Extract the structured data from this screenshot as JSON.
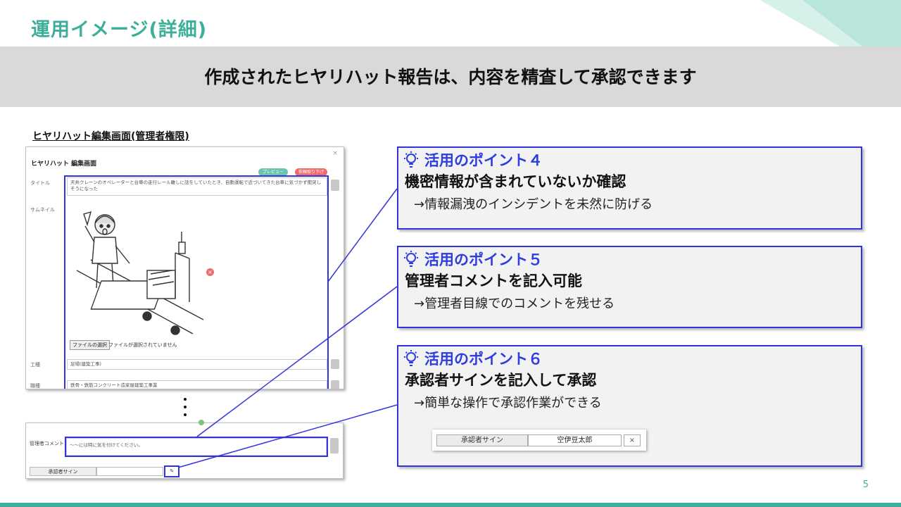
{
  "slide": {
    "title": "運用イメージ(詳細)",
    "headline": "作成されたヒヤリハット報告は、内容を精査して承認できます",
    "page_number": "5",
    "accent_color": "#3dae9a",
    "callout_color": "#2d3de0"
  },
  "screenshot_caption": "ヒヤリハット編集画面(管理者権限)",
  "edit_screen": {
    "title": "ヒヤリハット 編集画面",
    "close_icon": "close-icon",
    "preview_button": "プレビュー",
    "withdraw_button": "依頼取り下げ",
    "fields": {
      "title_label": "タイトル",
      "title_value": "天井クレーンのオペレーターと台車の走行レール離しに話をしていたとき、自動運転で近づいてきた台車に気づかず衝突しそうになった",
      "thumbnail_label": "サムネイル",
      "file_button": "ファイルの選択",
      "file_status": "ファイルが選択されていません",
      "work_type_label": "工種",
      "work_type_value": "足場(建築工事)",
      "job_type_label": "職種",
      "job_type_value": "鉄骨・鉄筋コンクリート造家屋建築工事業"
    },
    "remove_image_icon": "remove-circle-icon"
  },
  "admin_panel": {
    "comment_label": "管理者コメント",
    "comment_value": "～～には特に気を付けてください。",
    "sign_label": "承認者サイン",
    "edit_icon": "edit-icon"
  },
  "callouts": [
    {
      "label": "活用のポイント４",
      "heading": "機密情報が含まれていないか確認",
      "description": "→情報漏洩のインシデントを未然に防げる",
      "icon": "lightbulb-icon"
    },
    {
      "label": "活用のポイント５",
      "heading": "管理者コメントを記入可能",
      "description": "→管理者目線でのコメントを残せる",
      "icon": "lightbulb-icon"
    },
    {
      "label": "活用のポイント６",
      "heading": "承認者サインを記入して承認",
      "description": "→簡単な操作で承認作業ができる",
      "icon": "lightbulb-icon",
      "sign_example": {
        "label": "承認者サイン",
        "value": "空伊豆太郎",
        "clear": "×"
      }
    }
  ]
}
